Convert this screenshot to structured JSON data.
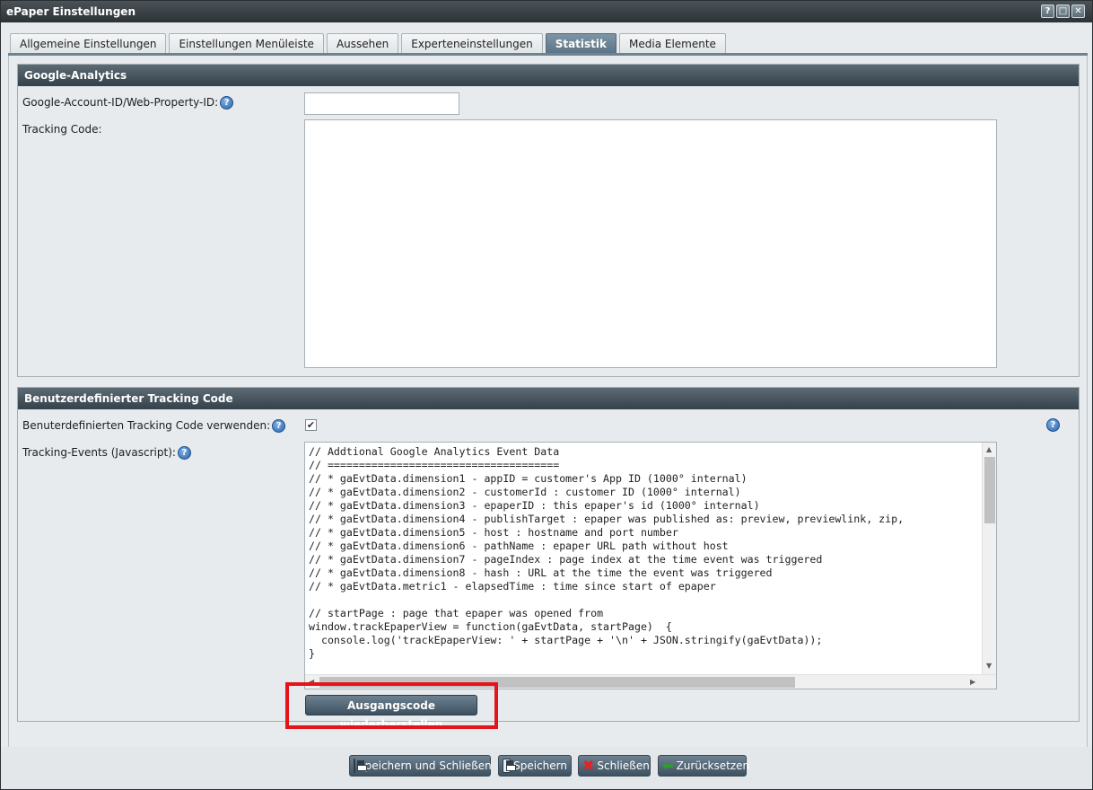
{
  "window": {
    "title": "ePaper Einstellungen",
    "controls": {
      "help": "?",
      "maximize": "□",
      "close": "✕"
    }
  },
  "tabs": [
    {
      "label": "Allgemeine Einstellungen",
      "active": false
    },
    {
      "label": "Einstellungen Menüleiste",
      "active": false
    },
    {
      "label": "Aussehen",
      "active": false
    },
    {
      "label": "Experteneinstellungen",
      "active": false
    },
    {
      "label": "Statistik",
      "active": true
    },
    {
      "label": "Media Elemente",
      "active": false
    }
  ],
  "google_analytics": {
    "title": "Google-Analytics",
    "account_label": "Google-Account-ID/Web-Property-ID:",
    "account_value": "",
    "tracking_code_label": "Tracking Code:",
    "tracking_code_value": ""
  },
  "custom_tracking": {
    "title": "Benutzerdefinierter Tracking Code",
    "use_label": "Benuterdefinierten Tracking Code verwenden:",
    "use_checked": true,
    "check_mark": "✔",
    "events_label": "Tracking-Events (Javascript):",
    "code": "// Addtional Google Analytics Event Data\n// =====================================\n// * gaEvtData.dimension1 - appID = customer's App ID (1000° internal)\n// * gaEvtData.dimension2 - customerId : customer ID (1000° internal)\n// * gaEvtData.dimension3 - epaperID : this epaper's id (1000° internal)\n// * gaEvtData.dimension4 - publishTarget : epaper was published as: preview, previewlink, zip,\n// * gaEvtData.dimension5 - host : hostname and port number\n// * gaEvtData.dimension6 - pathName : epaper URL path without host\n// * gaEvtData.dimension7 - pageIndex : page index at the time event was triggered\n// * gaEvtData.dimension8 - hash : URL at the time the event was triggered\n// * gaEvtData.metric1 - elapsedTime : time since start of epaper\n\n// startPage : page that epaper was opened from\nwindow.trackEpaperView = function(gaEvtData, startPage)  {\n  console.log('trackEpaperView: ' + startPage + '\\n' + JSON.stringify(gaEvtData));\n}",
    "restore_button": "Ausgangscode wiederherstellen"
  },
  "help_glyph": "?",
  "footer": {
    "save_close": "Speichern und Schließen",
    "save": "Speichern",
    "close": "Schließen",
    "reset": "Zurücksetzen"
  },
  "colors": {
    "highlight": "#e5141b",
    "header": "#3b4750",
    "active_tab": "#6a8295"
  }
}
